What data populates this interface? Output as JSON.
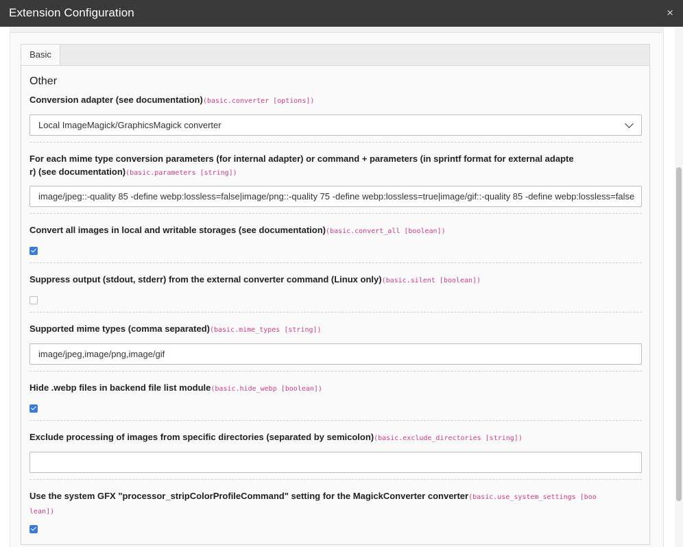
{
  "window": {
    "title": "Extension Configuration",
    "close_icon": "×"
  },
  "tabs": [
    {
      "label": "Basic",
      "active": true
    }
  ],
  "section": {
    "title": "Other"
  },
  "fields": {
    "converter": {
      "label": "Conversion adapter (see documentation)",
      "code": "(basic.converter [options])",
      "selected": "Local ImageMagick/GraphicsMagick converter"
    },
    "parameters": {
      "label_line1": "For each mime type conversion parameters (for internal adapter) or command + parameters (in sprintf format for external adapte",
      "label_line2": "r) (see documentation)",
      "code": "(basic.parameters [string])",
      "value": "image/jpeg::-quality 85 -define webp:lossless=false|image/png::-quality 75 -define webp:lossless=true|image/gif::-quality 85 -define webp:lossless=false"
    },
    "convert_all": {
      "label": "Convert all images in local and writable storages (see documentation)",
      "code": "(basic.convert_all [boolean])",
      "checked": true
    },
    "silent": {
      "label": "Suppress output (stdout, stderr) from the external converter command (Linux only)",
      "code": "(basic.silent [boolean])",
      "checked": false
    },
    "mime_types": {
      "label": "Supported mime types (comma separated)",
      "code": "(basic.mime_types [string])",
      "value": "image/jpeg,image/png,image/gif"
    },
    "hide_webp": {
      "label": "Hide .webp files in backend file list module",
      "code": "(basic.hide_webp [boolean])",
      "checked": true
    },
    "exclude_directories": {
      "label": "Exclude processing of images from specific directories (separated by semicolon)",
      "code": "(basic.exclude_directories [string])",
      "value": ""
    },
    "use_system_settings": {
      "label": "Use the system GFX \"processor_stripColorProfileCommand\" setting for the MagickConverter converter",
      "code_line1": "(basic.use_system_settings [boo",
      "code_line2": "lean])",
      "checked": true
    }
  }
}
